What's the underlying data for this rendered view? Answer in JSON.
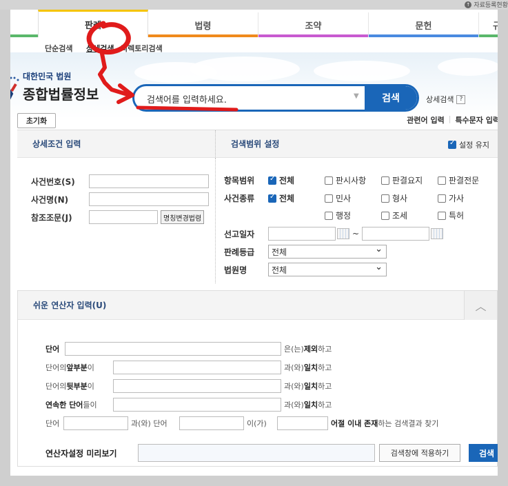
{
  "util_link": "자료등록현황",
  "tabs": [
    {
      "label": "판례",
      "bar": "#f5c400"
    },
    {
      "label": "법령",
      "bar": "#f08a1c"
    },
    {
      "label": "조약",
      "bar": "#c85ad0"
    },
    {
      "label": "문헌",
      "bar": "#4a8ae0"
    },
    {
      "label": "규",
      "bar": "#5ab86a"
    }
  ],
  "subnav": {
    "simple": "단순검색",
    "detail": "상세검색",
    "directory": "디렉토리검색"
  },
  "logo": {
    "line1": "대한민국 법원",
    "line2": "종합법률정보"
  },
  "search": {
    "placeholder": "검색어를 입력하세요.",
    "button": "검색"
  },
  "detail_link": "상세검색",
  "reset": "초기화",
  "right_links": [
    "관련어 입력",
    "특수문자 입력"
  ],
  "left_panel": {
    "title": "상세조건 입력",
    "fields": [
      {
        "label": "사건번호(S)",
        "value": ""
      },
      {
        "label": "사건명(N)",
        "value": ""
      },
      {
        "label": "참조조문(J)",
        "value": ""
      }
    ],
    "law_button": "명칭변경법령"
  },
  "right_panel": {
    "title": "검색범위 설정",
    "keep": "설정 유지",
    "scope_label": "항목범위",
    "scope_opts": [
      {
        "label": "전체",
        "checked": true
      },
      {
        "label": "판시사항",
        "checked": false
      },
      {
        "label": "판결요지",
        "checked": false
      },
      {
        "label": "판결전문",
        "checked": false
      }
    ],
    "type_label": "사건종류",
    "type_opts": [
      {
        "label": "전체",
        "checked": true
      },
      {
        "label": "민사",
        "checked": false
      },
      {
        "label": "형사",
        "checked": false
      },
      {
        "label": "가사",
        "checked": false
      },
      {
        "label": "행정",
        "checked": false
      },
      {
        "label": "조세",
        "checked": false
      },
      {
        "label": "특허",
        "checked": false
      }
    ],
    "date_label": "선고일자",
    "date_sep": "~",
    "grade_label": "판례등급",
    "grade_value": "전체",
    "court_label": "법원명",
    "court_value": "전체"
  },
  "operator": {
    "title": "쉬운 연산자 입력(U)",
    "rows": [
      {
        "pre": "단어",
        "post_plain": "은(는) ",
        "post_bold": "제외",
        "post_tail": "하고"
      },
      {
        "pre_plain": "단어의 ",
        "pre_bold": "앞부분",
        "pre_tail": "이",
        "post_plain": "과(와) ",
        "post_bold": "일치",
        "post_tail": "하고"
      },
      {
        "pre_plain": "단어의 ",
        "pre_bold": "뒷부분",
        "pre_tail": "이",
        "post_plain": "과(와) ",
        "post_bold": "일치",
        "post_tail": "하고"
      },
      {
        "pre_bold": "연속한 단어",
        "pre_tail": "들이",
        "post_plain": "과(와) ",
        "post_bold": "일치",
        "post_tail": "하고"
      }
    ],
    "near": {
      "w1": "단어",
      "mid": "과(와) 단어",
      "i": "이(가)",
      "bold": "어절 이내 존재",
      "tail": "하는 검색결과 찾기"
    },
    "preview_label": "연산자설정 미리보기",
    "apply": "검색창에 적용하기",
    "search": "검색"
  }
}
